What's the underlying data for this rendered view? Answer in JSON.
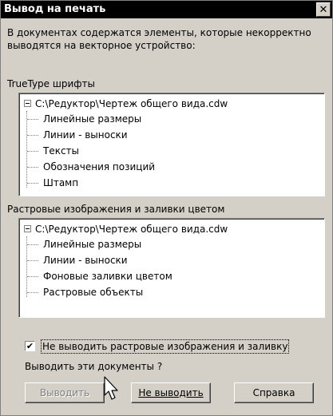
{
  "window": {
    "title": "Вывод на печать",
    "close_glyph": "✕"
  },
  "message": "В документах содержатся элементы, которые некорректно выводятся на векторное устройство:",
  "truetype_group": {
    "label": "TrueType шрифты",
    "root": "C:\\Редуктор\\Чертеж общего вида.cdw",
    "children": [
      "Линейные размеры",
      "Линии - выноски",
      "Тексты",
      "Обозначения позиций",
      "Штамп"
    ]
  },
  "raster_group": {
    "label": "Растровые изображения и заливки цветом",
    "root": "C:\\Редуктор\\Чертеж общего вида.cdw",
    "children": [
      "Линейные размеры",
      "Линии - выноски",
      "Фоновые заливки цветом",
      "Растровые объекты"
    ]
  },
  "checkbox": {
    "checked": true,
    "mark": "✔",
    "label": "Не выводить растровые изображения и заливку"
  },
  "question": "Выводить эти документы ?",
  "buttons": {
    "print": {
      "label": "Выводить",
      "enabled": false
    },
    "no_print": {
      "label": "Не выводить"
    },
    "help": {
      "label": "Справка"
    }
  },
  "colors": {
    "face": "#d4d0c8",
    "titlebar": "#000000",
    "disabled_text": "#808080"
  }
}
